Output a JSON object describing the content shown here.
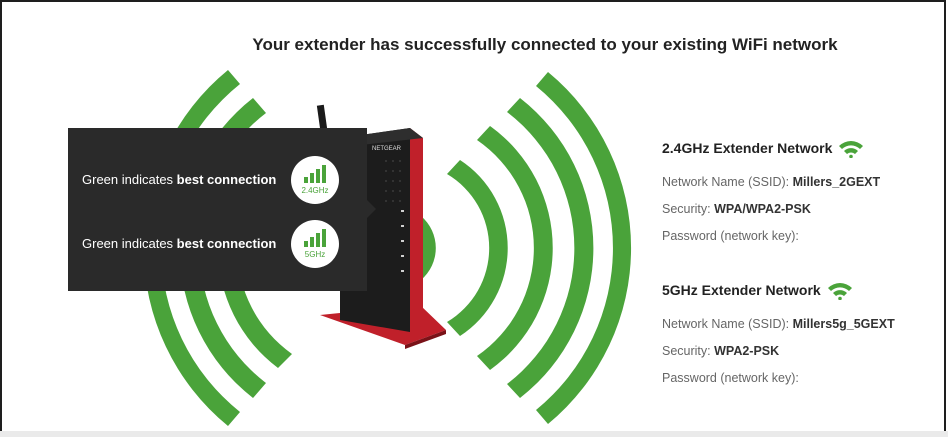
{
  "title": "Your extender has successfully connected to your existing WiFi network",
  "device_logo": "NETGEAR",
  "tooltip": {
    "row1_prefix": "Green indicates ",
    "row1_bold": "best connection",
    "row1_badge": "2.4GHz",
    "row2_prefix": "Green indicates ",
    "row2_bold": "best connection",
    "row2_badge": "5GHz"
  },
  "network_24": {
    "heading": "2.4GHz Extender Network",
    "ssid_label": "Network Name (SSID):",
    "ssid_value": "Millers_2GEXT",
    "security_label": "Security:",
    "security_value": "WPA/WPA2-PSK",
    "password_label": "Password (network key):"
  },
  "network_5": {
    "heading": "5GHz Extender Network",
    "ssid_label": "Network Name (SSID):",
    "ssid_value": "Millers5g_5GEXT",
    "security_label": "Security:",
    "security_value": "WPA2-PSK",
    "password_label": "Password (network key):"
  },
  "colors": {
    "signal_green": "#4aa33a",
    "tooltip_bg": "#2a2a2a",
    "device_red": "#c0202a"
  }
}
